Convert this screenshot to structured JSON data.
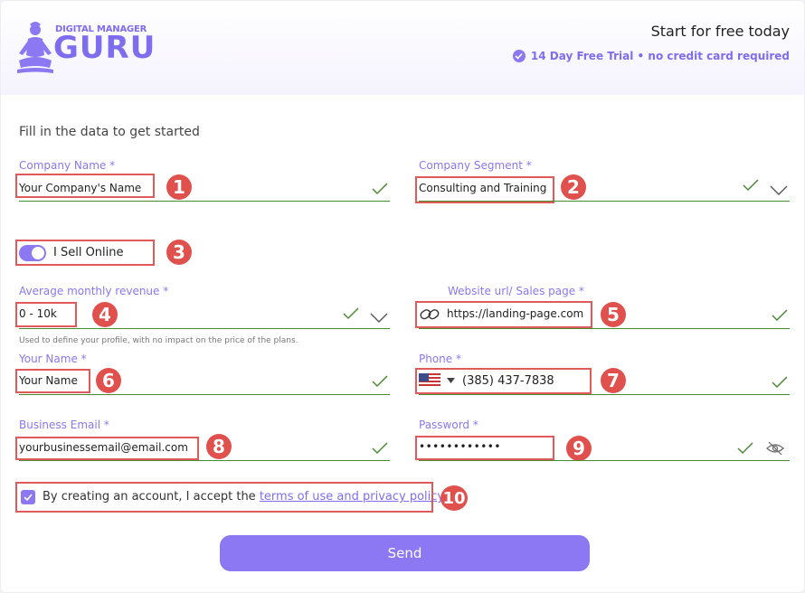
{
  "header": {
    "brand_top": "DIGITAL MANAGER",
    "brand_main": "GURU",
    "cta_title": "Start for free today",
    "trial_text": "14 Day Free Trial • no credit card required"
  },
  "form": {
    "intro": "Fill in the data to get started",
    "company_name": {
      "label": "Company Name *",
      "value": "Your Company's Name",
      "badge": "1"
    },
    "company_segment": {
      "label": "Company Segment *",
      "value": "Consulting and Training",
      "badge": "2"
    },
    "sell_online": {
      "label": "I Sell Online",
      "badge": "3",
      "on": true
    },
    "revenue": {
      "label": "Average monthly revenue *",
      "value": "0 - 10k",
      "badge": "4",
      "hint": "Used to define your profile, with no impact on the price of the plans."
    },
    "website": {
      "label": "Website url/ Sales page *",
      "value": "https://landing-page.com",
      "badge": "5"
    },
    "your_name": {
      "label": "Your Name *",
      "value": "Your Name",
      "badge": "6"
    },
    "phone": {
      "label": "Phone *",
      "value": "(385) 437-7838",
      "badge": "7"
    },
    "email": {
      "label": "Business Email *",
      "value": "yourbusinessemail@email.com",
      "badge": "8"
    },
    "password": {
      "label": "Password *",
      "value": "••••••••••••",
      "badge": "9"
    },
    "terms": {
      "prefix": "By creating an account, I accept the ",
      "link": "terms of use and privacy policy",
      "badge": "10",
      "checked": true
    },
    "send_label": "Send"
  },
  "colors": {
    "accent": "#8b78f2",
    "annotation": "#e0504c",
    "valid": "#4a8a32"
  }
}
